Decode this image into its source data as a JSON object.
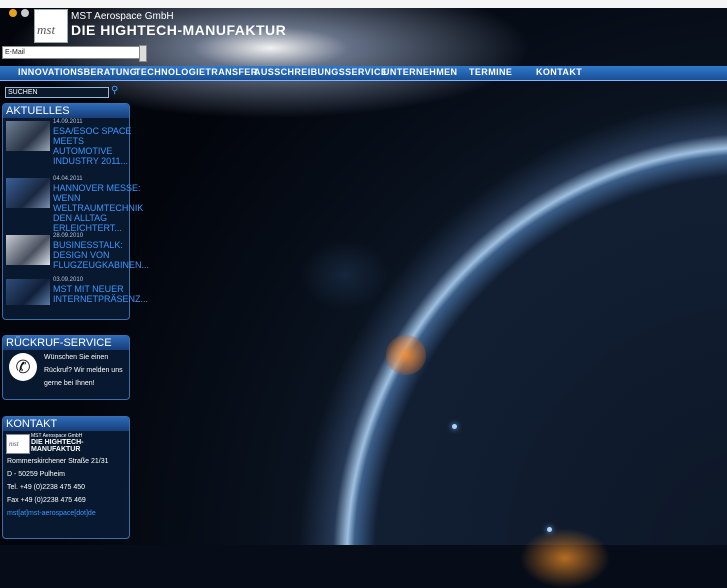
{
  "header": {
    "logo_text": "mst",
    "brand_small": "MST Aerospace GmbH",
    "brand_big": "DIE HIGHTECH-MANUFAKTUR",
    "email_placeholder": "E-Mail"
  },
  "nav": {
    "items": [
      "INNOVATIONSBERATUNG",
      "TECHNOLOGIETRANSFER",
      "AUSSCHREIBUNGSSERVICE",
      "UNTERNEHMEN",
      "TERMINE",
      "KONTAKT"
    ]
  },
  "search": {
    "label": "SUCHEN"
  },
  "aktuelles": {
    "title": "AKTUELLES",
    "items": [
      {
        "date": "14.09.2011",
        "title": "ESA/ESOC SPACE MEETS AUTOMOTIVE INDUSTRY 2011..."
      },
      {
        "date": "04.04.2011",
        "title": "HANNOVER MESSE: WENN WELTRAUMTECHNIK DEN ALLTAG ERLEICHTERT..."
      },
      {
        "date": "28.09.2010",
        "title": "BUSINESSTALK: DESIGN VON FLUGZEUGKABINEN..."
      },
      {
        "date": "03.09.2010",
        "title": "MST MIT NEUER INTERNETPRÄSENZ..."
      }
    ]
  },
  "rueckruf": {
    "title": "RÜCKRUF-SERVICE",
    "text": "Wünschen Sie einen Rückruf? Wir melden uns gerne bei Ihnen!"
  },
  "kontakt": {
    "title": "KONTAKT",
    "logo_text": "mst",
    "brand_small": "MST Aerospace GmbH",
    "brand_big": "DIE HIGHTECH-MANUFAKTUR",
    "street": "Rommerskirchener Straße 21/31",
    "city": "D - 50259 Pulheim",
    "tel": "Tel. +49 (0)2238 475 450",
    "fax": "Fax +49 (0)2238 475 469",
    "email": "mst[at]mst-aerospace[dot]de"
  },
  "colors": {
    "nav": "#2f79cc",
    "link": "#3a98ff",
    "panel_border": "#3d6ea8"
  }
}
